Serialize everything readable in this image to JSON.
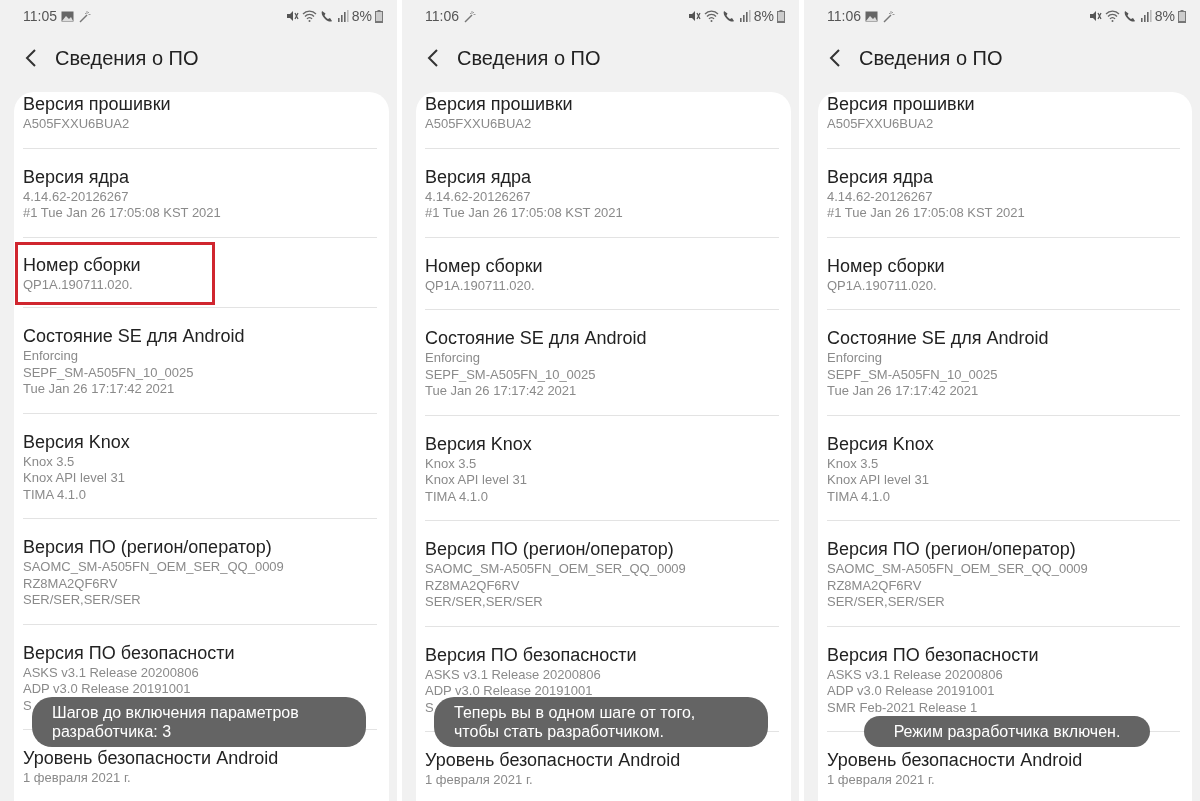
{
  "screens": [
    {
      "status_bar": {
        "time": "11:05",
        "image_notification": true,
        "battery": "8%"
      },
      "title": "Сведения о ПО",
      "items": [
        {
          "title": "Версия прошивки",
          "lines": [
            "A505FXXU6BUA2"
          ],
          "highlighted": false
        },
        {
          "title": "Версия ядра",
          "lines": [
            "4.14.62-20126267",
            "#1 Tue Jan 26 17:05:08 KST 2021"
          ],
          "highlighted": false
        },
        {
          "title": "Номер сборки",
          "lines": [
            "QP1A.190711.020."
          ],
          "highlighted": true
        },
        {
          "title": "Состояние SE для Android",
          "lines": [
            "Enforcing",
            "SEPF_SM-A505FN_10_0025",
            "Tue Jan 26 17:17:42 2021"
          ],
          "highlighted": false
        },
        {
          "title": "Версия Knox",
          "lines": [
            "Knox 3.5",
            "Knox API level 31",
            "TIMA 4.1.0"
          ],
          "highlighted": false
        },
        {
          "title": "Версия ПО (регион/оператор)",
          "lines": [
            "SAOMC_SM-A505FN_OEM_SER_QQ_0009",
            "RZ8MA2QF6RV",
            "SER/SER,SER/SER"
          ],
          "highlighted": false
        },
        {
          "title": "Версия ПО безопасности",
          "lines": [
            "ASKS v3.1 Release 20200806",
            "ADP v3.0 Release 20191001",
            "S"
          ],
          "highlighted": false
        },
        {
          "title": "Уровень безопасности Android",
          "lines": [
            "1 февраля 2021 г."
          ],
          "highlighted": false
        }
      ],
      "toast": {
        "text": "Шагов до включения параметров разработчика: 3",
        "kind": "wide"
      }
    },
    {
      "status_bar": {
        "time": "11:06",
        "image_notification": false,
        "battery": "8%"
      },
      "title": "Сведения о ПО",
      "items": [
        {
          "title": "Версия прошивки",
          "lines": [
            "A505FXXU6BUA2"
          ],
          "highlighted": false
        },
        {
          "title": "Версия ядра",
          "lines": [
            "4.14.62-20126267",
            "#1 Tue Jan 26 17:05:08 KST 2021"
          ],
          "highlighted": false
        },
        {
          "title": "Номер сборки",
          "lines": [
            "QP1A.190711.020."
          ],
          "highlighted": false
        },
        {
          "title": "Состояние SE для Android",
          "lines": [
            "Enforcing",
            "SEPF_SM-A505FN_10_0025",
            "Tue Jan 26 17:17:42 2021"
          ],
          "highlighted": false
        },
        {
          "title": "Версия Knox",
          "lines": [
            "Knox 3.5",
            "Knox API level 31",
            "TIMA 4.1.0"
          ],
          "highlighted": false
        },
        {
          "title": "Версия ПО (регион/оператор)",
          "lines": [
            "SAOMC_SM-A505FN_OEM_SER_QQ_0009",
            "RZ8MA2QF6RV",
            "SER/SER,SER/SER"
          ],
          "highlighted": false
        },
        {
          "title": "Версия ПО безопасности",
          "lines": [
            "ASKS v3.1 Release 20200806",
            "ADP v3.0 Release 20191001",
            "S"
          ],
          "highlighted": false
        },
        {
          "title": "Уровень безопасности Android",
          "lines": [
            "1 февраля 2021 г."
          ],
          "highlighted": false
        }
      ],
      "toast": {
        "text": "Теперь вы в одном шаге от того, чтобы стать разработчиком.",
        "kind": "wide"
      }
    },
    {
      "status_bar": {
        "time": "11:06",
        "image_notification": true,
        "battery": "8%"
      },
      "title": "Сведения о ПО",
      "items": [
        {
          "title": "Версия прошивки",
          "lines": [
            "A505FXXU6BUA2"
          ],
          "highlighted": false
        },
        {
          "title": "Версия ядра",
          "lines": [
            "4.14.62-20126267",
            "#1 Tue Jan 26 17:05:08 KST 2021"
          ],
          "highlighted": false
        },
        {
          "title": "Номер сборки",
          "lines": [
            "QP1A.190711.020."
          ],
          "highlighted": false
        },
        {
          "title": "Состояние SE для Android",
          "lines": [
            "Enforcing",
            "SEPF_SM-A505FN_10_0025",
            "Tue Jan 26 17:17:42 2021"
          ],
          "highlighted": false
        },
        {
          "title": "Версия Knox",
          "lines": [
            "Knox 3.5",
            "Knox API level 31",
            "TIMA 4.1.0"
          ],
          "highlighted": false
        },
        {
          "title": "Версия ПО (регион/оператор)",
          "lines": [
            "SAOMC_SM-A505FN_OEM_SER_QQ_0009",
            "RZ8MA2QF6RV",
            "SER/SER,SER/SER"
          ],
          "highlighted": false
        },
        {
          "title": "Версия ПО безопасности",
          "lines": [
            "ASKS v3.1 Release 20200806",
            "ADP v3.0 Release 20191001",
            "SMR Feb-2021 Release 1"
          ],
          "highlighted": false
        },
        {
          "title": "Уровень безопасности Android",
          "lines": [
            "1 февраля 2021 г."
          ],
          "highlighted": false
        }
      ],
      "toast": {
        "text": "Режим разработчика включен.",
        "kind": "short"
      }
    }
  ]
}
